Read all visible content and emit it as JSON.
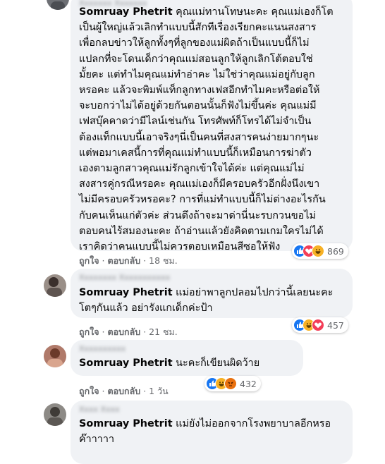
{
  "colors": {
    "bubble": "#f0f2f5",
    "like": "#1877f2",
    "love": "#f33e58",
    "haha": "#f7b125",
    "angry": "#e9710f"
  },
  "comments": [
    {
      "author_blurred": "Xxxxxxx Xxxxxxx",
      "mention": "Somruay Phetrit",
      "text": " คุณแม่ทานโทษนะคะ คุณแม่เองก็โต\nเป็นผู้ใหญ่แล้วเลิกทำแบบนี้สักทีเรื่องเรียกคะแนนสงสาร\nเพื่อกลบข่าวให้ลูกทั้งๆที่ลูกของแม่ผิดถ้าเป็นแบบนี้ก็ไม่\nแปลกที่จะโดนเด็กว่าคุณแม่สอนลูกให้ลูกเลิกโต้ตอบใช่\nมั้ยคะ แต่ทำไมคุณแม่ทำอ่าคะ ไม่ใช่ว่าคุณแม่อยู่กับลูก\nหรอคะ แล้วจะพิมพ์แท็กลูกทางเฟสอีกทำไมคะหรือต่อให้\nจะบอกว่าไม่ได้อยู่ด้วยกันตอนนั้นก็ฟังไม่ขึ้นค่ะ คุณแม่มี\nเฟสบุ๊คคาดว่ามีไลน์เช่นกัน โทรศัพท์ก็โทรได้ไม่จำเป็น\nต้องแท็กแบบนี้เอาจริงๆนี่เป็นคนที่สงสารคนง่ายมากๆนะ\nแต่พอมาเคสนี้การที่คุณแม่ทำแบบนี้ก็เหมือนการฆ่าตัว\nเองตามลูกสาวคุณแม่รักลูกเข้าใจได้ค่ะ แต่คุณแม่ไม่\nสงสารคู่กรณีหรอคะ คุณแม่เองก็มีครอบครัวอีกฝั่งนึงเขา\nไม่มีครอบครัวหรอคะ? การที่แม่ทำแบบนี้ก็ไม่ต่างอะไรกัน\nกับคนเห็นแก่ตัวค่ะ ส่วนดึงถ้าจะมาด่านี่นะรบกวนขอไม่\nตอบคนไร้สมองนะคะ ถ้าอ่านแล้วยังคิดตามเกมใครไม่ได้\nเราคิดว่าคนแบบนี้ไม่ควรตอบเหมือนสีซอให้ฟัง",
      "like_label": "ถูกใจ",
      "reply_label": "ตอบกลับ",
      "time": "18 ชม.",
      "reactions": [
        "like",
        "love",
        "haha"
      ],
      "reaction_count": "869"
    },
    {
      "author_blurred": "Xxxxxxxx Xxxxxxxxxxx",
      "mention": "Somruay Phetrit",
      "text": " แม่อย่าพาลูกปลอมไปกว่านี้เลยนะคะ\nโตๆกันแล้ว อย่ารังแกเด็กค่ะป้า",
      "like_label": "ถูกใจ",
      "reply_label": "ตอบกลับ",
      "time": "21 ชม.",
      "reactions": [
        "like",
        "haha",
        "love"
      ],
      "reaction_count": "457"
    },
    {
      "author_blurred": "Xxxxxxxxxx",
      "mention": "Somruay Phetrit",
      "text": " นะคะก็เขียนผิดว้าย",
      "like_label": "ถูกใจ",
      "reply_label": "ตอบกลับ",
      "time": "1 วัน",
      "reactions": [
        "like",
        "haha",
        "angry"
      ],
      "reaction_count": "432"
    },
    {
      "author_blurred": "Xxxx Xxxx",
      "mention": "Somruay Phetrit",
      "text": " แม่ยังไม่ออกจากโรงพยาบาลอีกหรอ\nค๊าาาาา"
    }
  ]
}
